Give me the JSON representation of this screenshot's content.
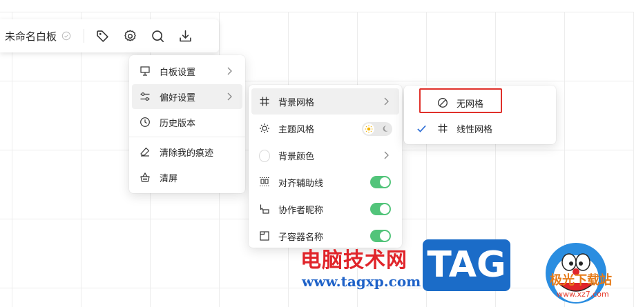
{
  "toolbar": {
    "doc_title": "未命名白板",
    "icons": [
      "check-circle-icon",
      "tag-icon",
      "gear-icon",
      "search-icon",
      "download-icon"
    ]
  },
  "menu_main": {
    "items": [
      {
        "label": "白板设置",
        "icon": "easel-icon",
        "has_submenu": true
      },
      {
        "label": "偏好设置",
        "icon": "sliders-icon",
        "has_submenu": true,
        "active": true
      },
      {
        "label": "历史版本",
        "icon": "clock-icon"
      },
      {
        "label": "清除我的痕迹",
        "icon": "eraser-icon"
      },
      {
        "label": "清屏",
        "icon": "basket-icon"
      }
    ]
  },
  "menu_preferences": {
    "items": [
      {
        "label": "背景网格",
        "icon": "grid-icon",
        "has_submenu": true,
        "active": true
      },
      {
        "label": "主题风格",
        "icon": "sun-icon",
        "control": "theme-toggle",
        "value": "light"
      },
      {
        "label": "背景颜色",
        "icon": "color-swatch",
        "has_submenu": true
      },
      {
        "label": "对齐辅助线",
        "icon": "align-guides-icon",
        "control": "toggle",
        "value": true
      },
      {
        "label": "协作者昵称",
        "icon": "cursor-flag-icon",
        "control": "toggle",
        "value": true
      },
      {
        "label": "子容器名称",
        "icon": "frame-icon",
        "control": "toggle",
        "value": true
      }
    ]
  },
  "menu_grid": {
    "items": [
      {
        "label": "无网格",
        "icon": "no-entry-icon",
        "highlighted": true,
        "checked": false
      },
      {
        "label": "线性网格",
        "icon": "grid-icon",
        "checked": true
      }
    ]
  },
  "watermark": {
    "cn": "电脑技术网",
    "url": "www.tagxp.com",
    "tag": "TAG",
    "site": "极光下载站",
    "domain": "www.xz7.com"
  },
  "colors": {
    "toggle_on": "#52c47a",
    "check": "#2f6fd6",
    "highlight_box": "#e0302a",
    "watermark_red": "#e0242a",
    "watermark_blue": "#1b6cc8"
  }
}
